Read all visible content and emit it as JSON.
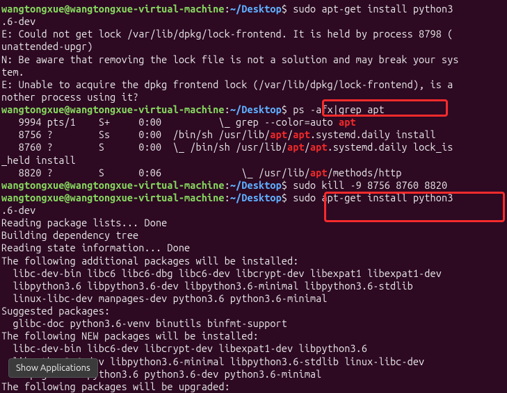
{
  "prompt": {
    "user_host": "wangtongxue@wangtongxue-virtual-machine",
    "colon": ":",
    "path": "~/Desktop",
    "dollar": "$"
  },
  "cmd1": " sudo apt-get install python3",
  "cmd1_cont": ".6-dev",
  "err1": "E: Could not get lock /var/lib/dpkg/lock-frontend. It is held by process 8798 (",
  "err1b": "unattended-upgr)",
  "note1": "N: Be aware that removing the lock file is not a solution and may break your sys",
  "note1b": "tem.",
  "err2": "E: Unable to acquire the dpkg frontend lock (/var/lib/dpkg/lock-frontend), is a",
  "err2b": "nother process using it?",
  "cmd2": " ps -afx|grep apt",
  "ps1a": "   9994 pts/1    S+     0:00          \\_ grep --color=auto ",
  "ps1b": "apt",
  "ps2a": "   8756 ?        Ss     0:00  /bin/sh /usr/lib/",
  "ps2b": "apt",
  "ps2c": "/",
  "ps2d": "apt",
  "ps2e": ".systemd.daily install",
  "ps3a": "   8760 ?        S      0:00  \\_ /bin/sh /usr/lib/",
  "ps3e": ".systemd.daily lock_is",
  "ps3f": "_held install",
  "ps4a": "   8820 ?        S      0:06              \\_ /usr/lib/",
  "ps4b": "apt",
  "ps4c": "/methods/http",
  "cmd3": " sudo kill -9 8756 8760 8820",
  "cmd4": " sudo apt-get install python3",
  "cmd4_cont": ".6-dev",
  "out": {
    "l1": "Reading package lists... Done",
    "l2": "Building dependency tree",
    "l3": "Reading state information... Done",
    "l4": "The following additional packages will be installed:",
    "l5": "  libc-dev-bin libc6 libc6-dbg libc6-dev libcrypt-dev libexpat1 libexpat1-dev",
    "l6": "  libpython3.6 libpython3.6-dev libpython3.6-minimal libpython3.6-stdlib",
    "l7": "  linux-libc-dev manpages-dev python3.6 python3.6-minimal",
    "l8": "Suggested packages:",
    "l9": "  glibc-doc python3.6-venv binutils binfmt-support",
    "l10": "The following NEW packages will be installed:",
    "l11": "  libc-dev-bin libc6-dev libcrypt-dev libexpat1-dev libpython3.6",
    "l12": "  libpython3.6-dev libpython3.6-minimal libpython3.6-stdlib linux-libc-dev",
    "l13": "  manpages-dev python3.6 python3.6-dev python3.6-minimal",
    "l14": "The following packages will be upgraded:"
  },
  "tooltip": "Show Applications"
}
